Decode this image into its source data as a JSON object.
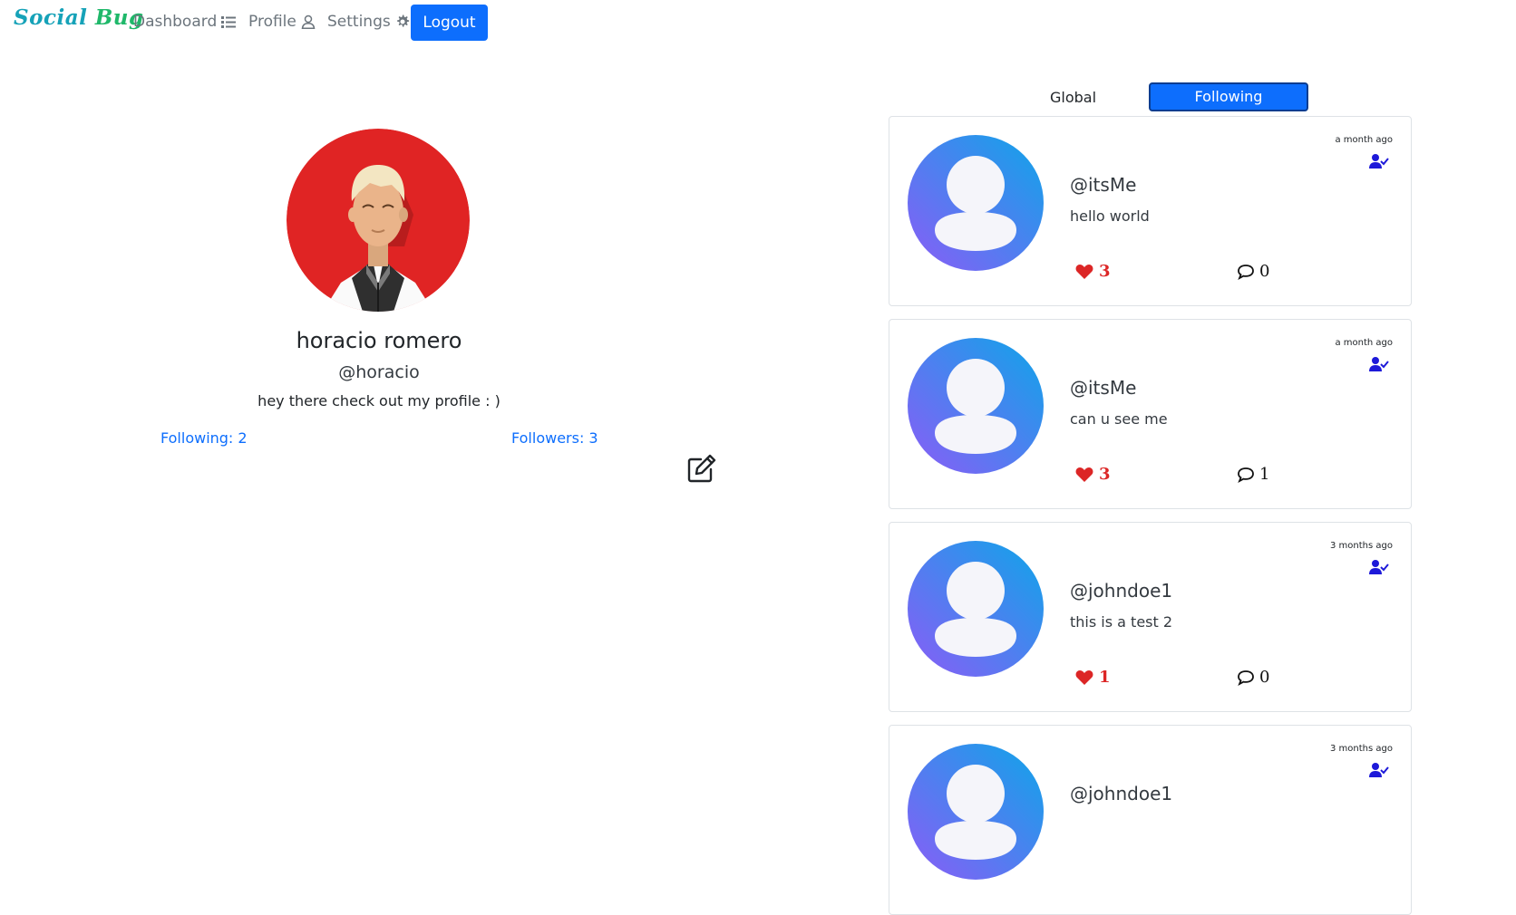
{
  "nav": {
    "brand_part1": "Social",
    "brand_part2": "Bug",
    "dashboard_label": "Dashboard",
    "dashboard_icon": "list-icon",
    "profile_label": "Profile",
    "profile_icon": "user-icon",
    "settings_label": "Settings",
    "settings_icon": "gear-icon",
    "logout_label": "Logout"
  },
  "profile": {
    "name": "horacio romero",
    "handle": "@horacio",
    "bio": "hey there check out my profile : )",
    "following": "Following: 2",
    "followers": "Followers: 3",
    "avatar_icon": "cartoon-man-avatar",
    "edit_icon": "edit-square-icon"
  },
  "tabs": {
    "global_label": "Global",
    "following_label": "Following",
    "active": "Following"
  },
  "posts": [
    {
      "time": "a month ago",
      "user": "@itsMe",
      "content": "hello world",
      "likes": "3",
      "comments": "0"
    },
    {
      "time": "a month ago",
      "user": "@itsMe",
      "content": "can u see me",
      "likes": "3",
      "comments": "1"
    },
    {
      "time": "3 months ago",
      "user": "@johndoe1",
      "content": "this is a test 2",
      "likes": "1",
      "comments": "0"
    },
    {
      "time": "3 months ago",
      "user": "@johndoe1",
      "content": "",
      "likes": "",
      "comments": ""
    }
  ],
  "colors": {
    "primary": "#0d6efd",
    "like": "#dc2626",
    "follow_icon": "#1d19d9",
    "avatar_red": "#e02424",
    "post_avatar_from": "#8b5cf6",
    "post_avatar_to": "#0ea5e9"
  }
}
